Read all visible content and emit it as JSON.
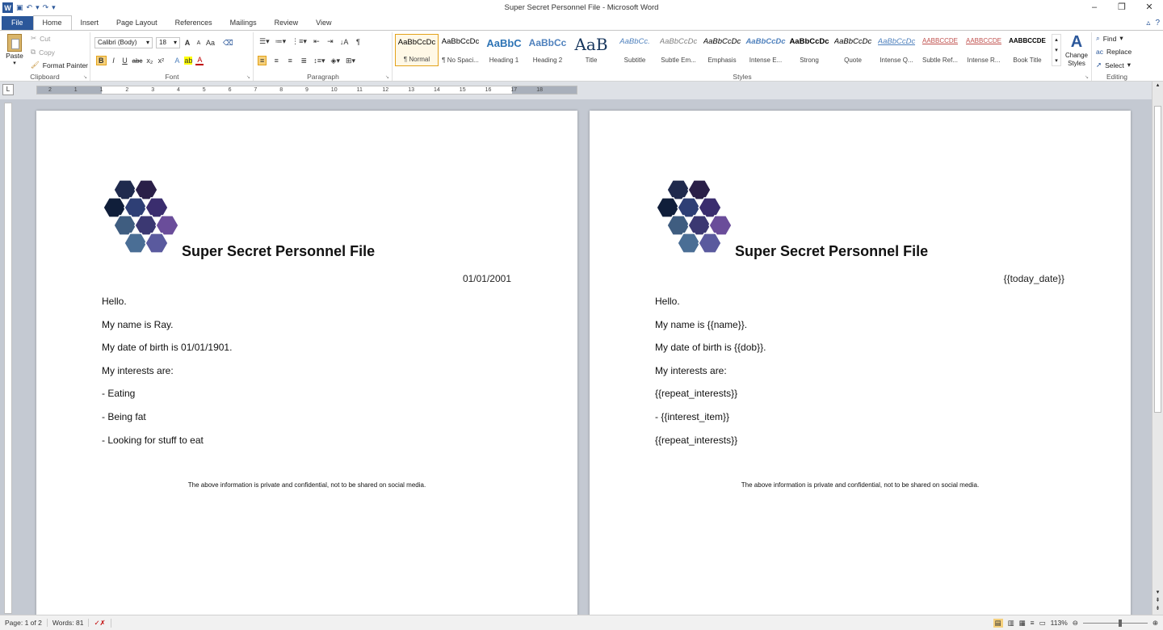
{
  "window": {
    "title": "Super Secret Personnel File - Microsoft Word"
  },
  "qat": {
    "undo": "↶",
    "redo": "↷"
  },
  "tabs": [
    "File",
    "Home",
    "Insert",
    "Page Layout",
    "References",
    "Mailings",
    "Review",
    "View"
  ],
  "clipboard": {
    "paste": "Paste",
    "cut": "Cut",
    "copy": "Copy",
    "format_painter": "Format Painter",
    "label": "Clipboard"
  },
  "font": {
    "family": "Calibri (Body)",
    "size": "18",
    "label": "Font",
    "bold": "B",
    "italic": "I",
    "underline": "U",
    "strike": "abc",
    "sub": "x₂",
    "sup": "x²",
    "grow": "A",
    "shrink": "A",
    "case": "Aa"
  },
  "paragraph": {
    "label": "Paragraph"
  },
  "styles": {
    "label": "Styles",
    "items": [
      {
        "preview": "AaBbCcDc",
        "name": "¶ Normal",
        "color": "#000000"
      },
      {
        "preview": "AaBbCcDc",
        "name": "¶ No Spaci...",
        "color": "#000000"
      },
      {
        "preview": "AaBbC",
        "name": "Heading 1",
        "color": "#2e74b5"
      },
      {
        "preview": "AaBbCc",
        "name": "Heading 2",
        "color": "#4f81bd"
      },
      {
        "preview": "AaB",
        "name": "Title",
        "color": "#17365d"
      },
      {
        "preview": "AaBbCc.",
        "name": "Subtitle",
        "color": "#4f81bd"
      },
      {
        "preview": "AaBbCcDc",
        "name": "Subtle Em...",
        "color": "#808080"
      },
      {
        "preview": "AaBbCcDc",
        "name": "Emphasis",
        "color": "#000000"
      },
      {
        "preview": "AaBbCcDc",
        "name": "Intense E...",
        "color": "#4f81bd"
      },
      {
        "preview": "AaBbCcDc",
        "name": "Strong",
        "color": "#000000"
      },
      {
        "preview": "AaBbCcDc",
        "name": "Quote",
        "color": "#000000"
      },
      {
        "preview": "AaBbCcDc",
        "name": "Intense Q...",
        "color": "#4f81bd"
      },
      {
        "preview": "AABBCCDE",
        "name": "Subtle Ref...",
        "color": "#c0504d"
      },
      {
        "preview": "AABBCCDE",
        "name": "Intense R...",
        "color": "#c0504d"
      },
      {
        "preview": "AABBCCDE",
        "name": "Book Title",
        "color": "#000000"
      }
    ],
    "change": "Change Styles"
  },
  "editing": {
    "find": "Find",
    "replace": "Replace",
    "select": "Select",
    "label": "Editing"
  },
  "ruler_numbers": [
    "2",
    "1",
    "1",
    "2",
    "3",
    "4",
    "5",
    "6",
    "7",
    "8",
    "9",
    "10",
    "11",
    "12",
    "13",
    "14",
    "15",
    "16",
    "17",
    "18"
  ],
  "pages": [
    {
      "title": "Super Secret Personnel File",
      "date": "01/01/2001",
      "lines": [
        "Hello.",
        "My name is Ray.",
        "My date of birth is 01/01/1901.",
        "My interests are:",
        "- Eating",
        "- Being fat",
        "- Looking for stuff to eat"
      ],
      "footer": "The above information is private and confidential, not to be shared on social media."
    },
    {
      "title": "Super Secret Personnel File",
      "date": "{{today_date}}",
      "lines": [
        "Hello.",
        "My name is {{name}}.",
        "My date of birth is {{dob}}.",
        "My interests are:",
        "{{repeat_interests}}",
        "- {{interest_item}}",
        "{{repeat_interests}}"
      ],
      "footer": "The above information is private and confidential, not to be shared on social media."
    }
  ],
  "status": {
    "page": "Page: 1 of 2",
    "words": "Words: 81",
    "zoom": "113%"
  }
}
